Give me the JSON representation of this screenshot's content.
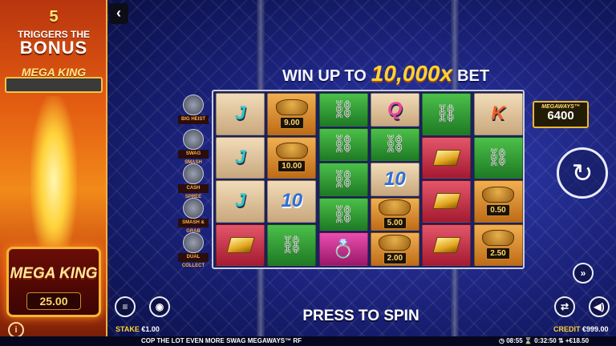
{
  "left_panel": {
    "trigger_count": "5",
    "trigger_line1": "TRIGGERS THE",
    "trigger_line2": "BONUS",
    "feature_label": "MEGA KING",
    "plaque_title": "MEGA KING",
    "plaque_value": "25.00"
  },
  "headline": {
    "part1": "WIN UP TO",
    "part2": "10,000x",
    "part3": "BET"
  },
  "modifiers": [
    {
      "label": "BIG HEIST"
    },
    {
      "label": "SWAG SMASH"
    },
    {
      "label": "CASH SPREE"
    },
    {
      "label": "SMASH & GRAB"
    },
    {
      "label": "DUAL COLLECT"
    }
  ],
  "reels": [
    [
      {
        "type": "letter",
        "value": "J",
        "bg": "tan"
      },
      {
        "type": "letter",
        "value": "J",
        "bg": "tan"
      },
      {
        "type": "letter",
        "value": "J",
        "bg": "tan"
      },
      {
        "type": "gold",
        "bg": "red"
      }
    ],
    [
      {
        "type": "bag",
        "value": "9.00",
        "bg": "orange"
      },
      {
        "type": "bag",
        "value": "10.00",
        "bg": "orange"
      },
      {
        "type": "letter",
        "value": "10",
        "bg": "tan"
      },
      {
        "type": "cuffs",
        "bg": "green"
      }
    ],
    [
      {
        "type": "cuffs",
        "bg": "green"
      },
      {
        "type": "cuffs",
        "bg": "green"
      },
      {
        "type": "cuffs",
        "bg": "green"
      },
      {
        "type": "cuffs",
        "bg": "green"
      },
      {
        "type": "ring",
        "bg": "pink"
      }
    ],
    [
      {
        "type": "letter",
        "value": "Q",
        "bg": "tan"
      },
      {
        "type": "cuffs",
        "bg": "green"
      },
      {
        "type": "letter",
        "value": "10",
        "bg": "tan"
      },
      {
        "type": "bag",
        "value": "5.00",
        "bg": "orange"
      },
      {
        "type": "bag",
        "value": "2.00",
        "bg": "orange"
      }
    ],
    [
      {
        "type": "cuffs",
        "bg": "green"
      },
      {
        "type": "gold",
        "bg": "red"
      },
      {
        "type": "gold",
        "bg": "red"
      },
      {
        "type": "gold",
        "bg": "red"
      }
    ],
    [
      {
        "type": "letter",
        "value": "K",
        "bg": "tan"
      },
      {
        "type": "cuffs",
        "bg": "green"
      },
      {
        "type": "bag",
        "value": "0.50",
        "bg": "orange"
      },
      {
        "type": "bag",
        "value": "2.50",
        "bg": "orange"
      }
    ]
  ],
  "megaways": {
    "title": "MEGAWAYS™",
    "value": "6400"
  },
  "spin_prompt": "PRESS TO SPIN",
  "stake": {
    "label": "STAKE",
    "value": "€1.00"
  },
  "credit": {
    "label": "CREDIT",
    "value": "€999.00"
  },
  "footer": {
    "game_name": "COP THE LOT EVEN MORE SWAG MEGAWAYS™ RF",
    "clock": "08:55",
    "session": "0:32:50",
    "net": "+€18.50"
  },
  "icons": {
    "back": "chevron-left-icon",
    "info": "info-icon",
    "menu": "menu-icon",
    "bet": "coins-icon",
    "autoplay": "autoplay-icon",
    "turbo": "turbo-icon",
    "sound": "speaker-icon",
    "spin": "spin-icon"
  }
}
